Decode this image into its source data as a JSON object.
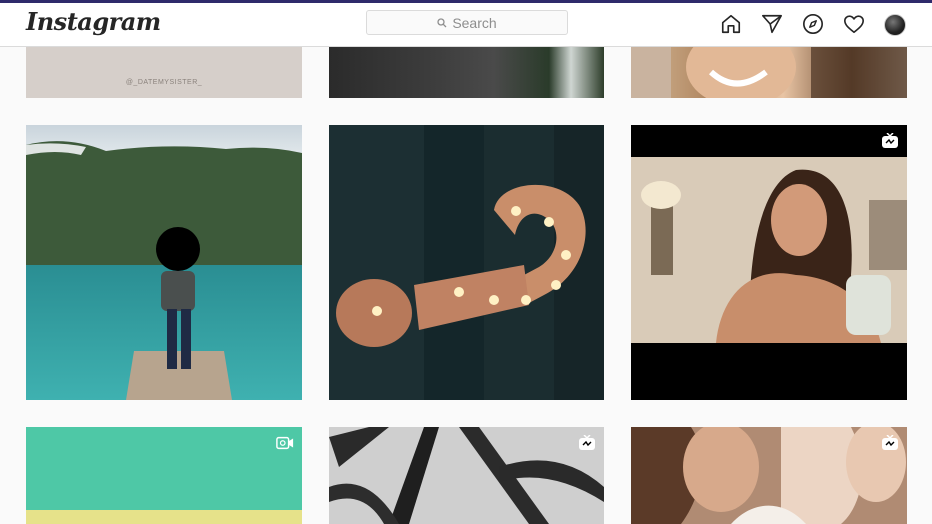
{
  "app": {
    "logo_text": "Instagram",
    "brand_color": "#262626",
    "accent_bar_color": "#2f2a6b"
  },
  "search": {
    "placeholder": "Search",
    "icon": "search-icon"
  },
  "nav": [
    {
      "icon": "home-icon"
    },
    {
      "icon": "direct-message-icon"
    },
    {
      "icon": "explore-compass-icon"
    },
    {
      "icon": "activity-heart-icon"
    },
    {
      "icon": "profile-avatar"
    }
  ],
  "grid": {
    "rows": [
      [
        {
          "kind": "photo",
          "watermark": "@_DATEMYSISTER_"
        },
        {
          "kind": "photo"
        },
        {
          "kind": "photo"
        }
      ],
      [
        {
          "kind": "photo",
          "subject": "person on dock by lake"
        },
        {
          "kind": "photo",
          "subject": "marquee question mark"
        },
        {
          "kind": "igtv",
          "badge_icon": "igtv-icon"
        }
      ],
      [
        {
          "kind": "video",
          "badge_icon": "video-camera-icon"
        },
        {
          "kind": "igtv",
          "badge_icon": "igtv-icon"
        },
        {
          "kind": "igtv",
          "badge_icon": "igtv-icon"
        }
      ]
    ]
  }
}
